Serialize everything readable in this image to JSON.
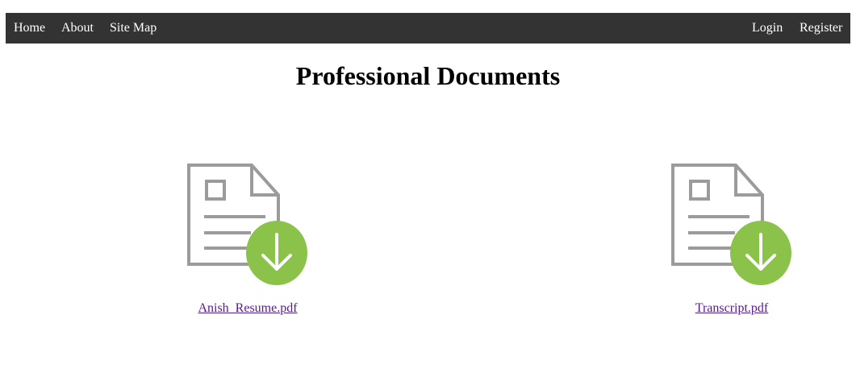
{
  "nav": {
    "left": [
      "Home",
      "About",
      "Site Map"
    ],
    "right": [
      "Login",
      "Register"
    ],
    "background": "#333333",
    "text_color": "#ffffff"
  },
  "page_title": "Professional Documents",
  "documents": [
    {
      "filename": "Anish_Resume.pdf",
      "icon": "document-download-icon"
    },
    {
      "filename": "Transcript.pdf",
      "icon": "document-download-icon"
    }
  ],
  "colors": {
    "icon_gray": "#9b9b9b",
    "download_green": "#8bc34a",
    "link_visited": "#551a8b"
  }
}
